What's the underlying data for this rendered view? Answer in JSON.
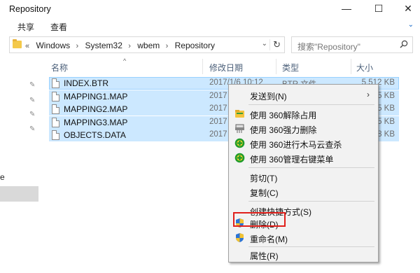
{
  "window": {
    "title": "Repository",
    "min_glyph": "—",
    "max_glyph": "☐",
    "close_glyph": "✕"
  },
  "ribbon": {
    "tabs": [
      "共享",
      "查看"
    ],
    "expand_glyph": "⌄"
  },
  "address": {
    "overflow": "«",
    "crumbs": [
      "Windows",
      "System32",
      "wbem",
      "Repository"
    ],
    "separator": "›",
    "dropdown_glyph": "⌄",
    "refresh_glyph": "↻"
  },
  "search": {
    "placeholder": "搜索\"Repository\""
  },
  "nav": {
    "partial_text": "e"
  },
  "columns": {
    "name": "名称",
    "modified": "修改日期",
    "type": "类型",
    "size": "大小",
    "sort_glyph": "^"
  },
  "files": [
    {
      "name": "INDEX.BTR",
      "date": "2017/1/6 10:12",
      "type": "BTR 文件",
      "size": "5,512 KB"
    },
    {
      "name": "MAPPING1.MAP",
      "date": "2017",
      "type": "",
      "size": "35 KB"
    },
    {
      "name": "MAPPING2.MAP",
      "date": "2017",
      "type": "",
      "size": "35 KB"
    },
    {
      "name": "MAPPING3.MAP",
      "date": "2017",
      "type": "",
      "size": "35 KB"
    },
    {
      "name": "OBJECTS.DATA",
      "date": "2017",
      "type": "",
      "size": "58 KB"
    }
  ],
  "context_menu": {
    "send_to": "发送到(N)",
    "send_to_arrow": "›",
    "unlock_360": "使用 360解除占用",
    "force_delete_360": "使用 360强力删除",
    "trojan_scan_360": "使用 360进行木马云查杀",
    "manage_menu_360": "使用 360管理右键菜单",
    "cut": "剪切(T)",
    "copy": "复制(C)",
    "create_shortcut": "创建快捷方式(S)",
    "delete": "删除(D)",
    "rename": "重命名(M)",
    "properties": "属性(R)"
  },
  "colors": {
    "selection": "#cce8ff",
    "highlight_box": "#e0201b",
    "menu_bg": "#f2f2f2"
  }
}
